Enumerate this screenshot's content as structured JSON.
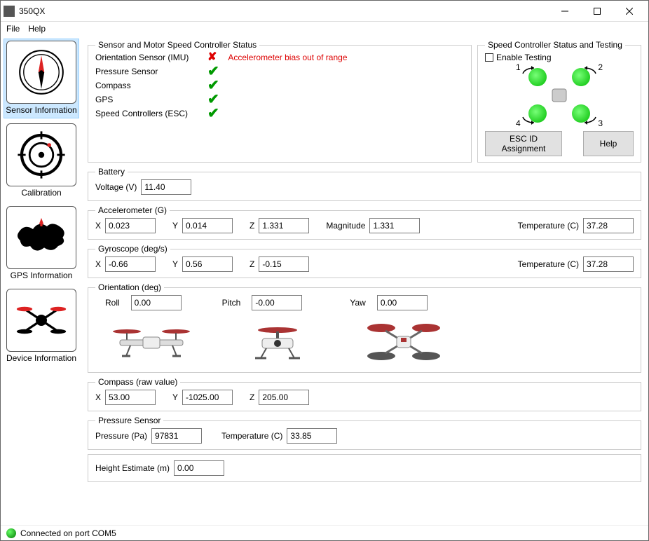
{
  "window": {
    "title": "350QX"
  },
  "menu": {
    "file": "File",
    "help": "Help"
  },
  "sidebar": {
    "items": [
      {
        "label": "Sensor Information"
      },
      {
        "label": "Calibration"
      },
      {
        "label": "GPS Information"
      },
      {
        "label": "Device Information"
      }
    ]
  },
  "status_panel": {
    "title": "Sensor and Motor Speed Controller Status",
    "rows": [
      {
        "label": "Orientation Sensor (IMU)",
        "ok": false,
        "error": "Accelerometer bias out of range"
      },
      {
        "label": "Pressure Sensor",
        "ok": true
      },
      {
        "label": "Compass",
        "ok": true
      },
      {
        "label": "GPS",
        "ok": true
      },
      {
        "label": "Speed Controllers (ESC)",
        "ok": true
      }
    ]
  },
  "esc_panel": {
    "title": "Speed Controller Status and Testing",
    "enable_testing": "Enable Testing",
    "motor_labels": {
      "m1": "1",
      "m2": "2",
      "m3": "3",
      "m4": "4"
    },
    "esc_id_btn": "ESC ID Assignment",
    "help_btn": "Help"
  },
  "battery": {
    "title": "Battery",
    "voltage_label": "Voltage (V)",
    "voltage": "11.40"
  },
  "accel": {
    "title": "Accelerometer (G)",
    "x_label": "X",
    "x": "0.023",
    "y_label": "Y",
    "y": "0.014",
    "z_label": "Z",
    "z": "1.331",
    "mag_label": "Magnitude",
    "mag": "1.331",
    "temp_label": "Temperature (C)",
    "temp": "37.28"
  },
  "gyro": {
    "title": "Gyroscope (deg/s)",
    "x_label": "X",
    "x": "-0.66",
    "y_label": "Y",
    "y": "0.56",
    "z_label": "Z",
    "z": "-0.15",
    "temp_label": "Temperature (C)",
    "temp": "37.28"
  },
  "orient": {
    "title": "Orientation (deg)",
    "roll_label": "Roll",
    "roll": "0.00",
    "pitch_label": "Pitch",
    "pitch": "-0.00",
    "yaw_label": "Yaw",
    "yaw": "0.00"
  },
  "compass": {
    "title": "Compass (raw value)",
    "x_label": "X",
    "x": "53.00",
    "y_label": "Y",
    "y": "-1025.00",
    "z_label": "Z",
    "z": "205.00"
  },
  "pressure": {
    "title": "Pressure Sensor",
    "p_label": "Pressure (Pa)",
    "p": "97831",
    "temp_label": "Temperature (C)",
    "temp": "33.85"
  },
  "height": {
    "title": "",
    "label": "Height Estimate (m)",
    "value": "0.00"
  },
  "statusbar": {
    "text": "Connected on port COM5"
  }
}
